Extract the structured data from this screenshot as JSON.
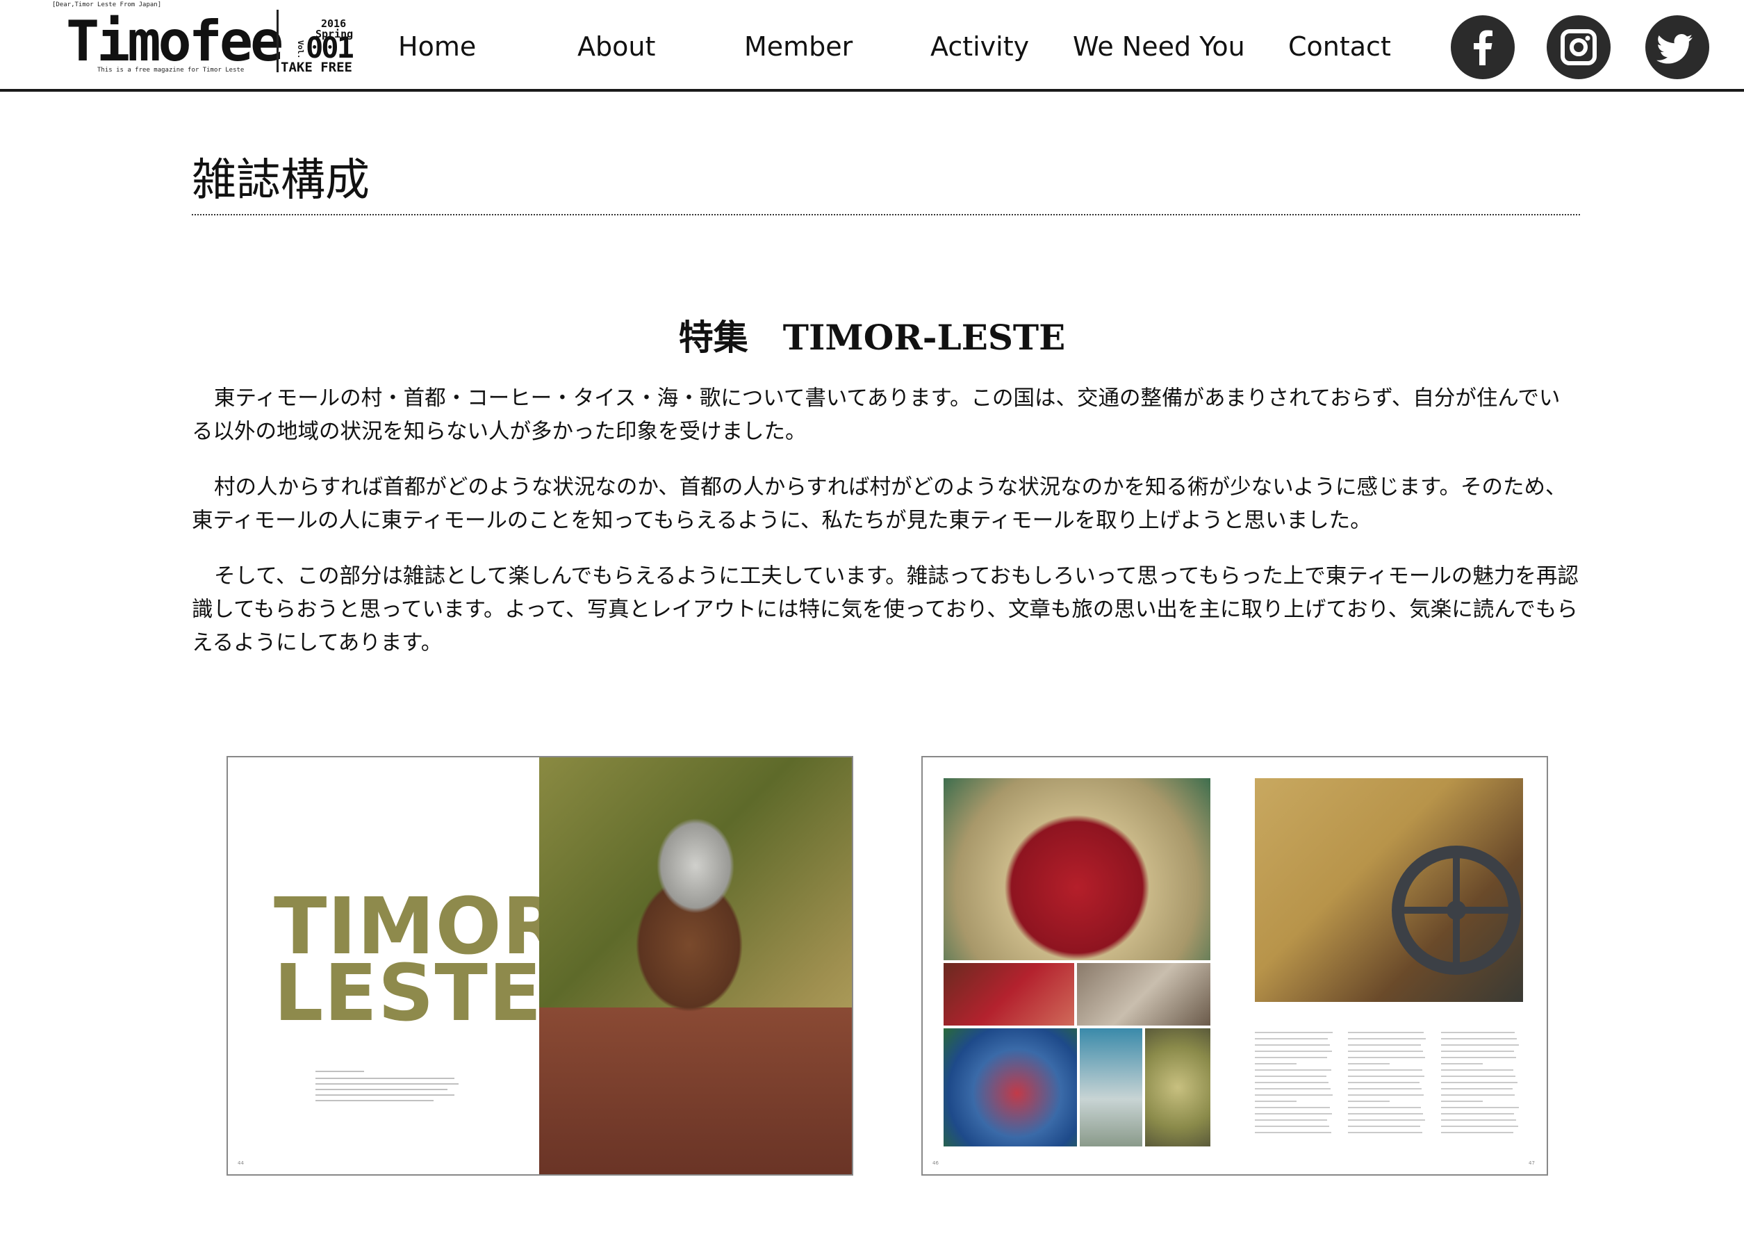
{
  "header": {
    "logo": {
      "tagline_top": "[Dear,Timor Leste From Japan]",
      "wordmark": "Timofee",
      "tagline_bottom": "This is a free magazine for Timor Leste",
      "issue_year": "2016",
      "issue_season": "Spring",
      "issue_vol": "Vol.",
      "issue_number": "001",
      "issue_take_free": "TAKE FREE"
    },
    "nav": [
      {
        "label": "Home"
      },
      {
        "label": "About"
      },
      {
        "label": "Member"
      },
      {
        "label": "Activity"
      },
      {
        "label": "We Need You"
      },
      {
        "label": "Contact"
      }
    ],
    "social": [
      {
        "icon": "facebook-icon"
      },
      {
        "icon": "instagram-icon"
      },
      {
        "icon": "twitter-icon"
      }
    ]
  },
  "main": {
    "page_title": "雑誌構成",
    "section_heading": "特集　TIMOR-LESTE",
    "paragraphs": [
      "東ティモールの村・首都・コーヒー・タイス・海・歌について書いてあります。この国は、交通の整備があまりされておらず、自分が住んでいる以外の地域の状況を知らない人が多かった印象を受けました。",
      "村の人からすれば首都がどのような状況なのか、首都の人からすれば村がどのような状況なのかを知る術が少ないように感じます。そのため、東ティモールの人に東ティモールのことを知ってもらえるように、私たちが見た東ティモールを取り上げようと思いました。",
      "そして、この部分は雑誌として楽しんでもらえるように工夫しています。雑誌っておもしろいって思ってもらった上で東ティモールの魅力を再認識してもらおうと思っています。よって、写真とレイアウトには特に気を使っており、文章も旅の思い出を主に取り上げており、気楽に読んでもらえるようにしてあります。"
    ],
    "spreads": [
      {
        "cover_text": "TIMOR\nLESTE",
        "page_left": "44",
        "page_right": ""
      },
      {
        "page_left": "46",
        "page_right": "47"
      }
    ]
  },
  "colors": {
    "header_rule": "#1a1a1a",
    "social_icon_bg": "#2b2b2b",
    "text": "#111111"
  }
}
